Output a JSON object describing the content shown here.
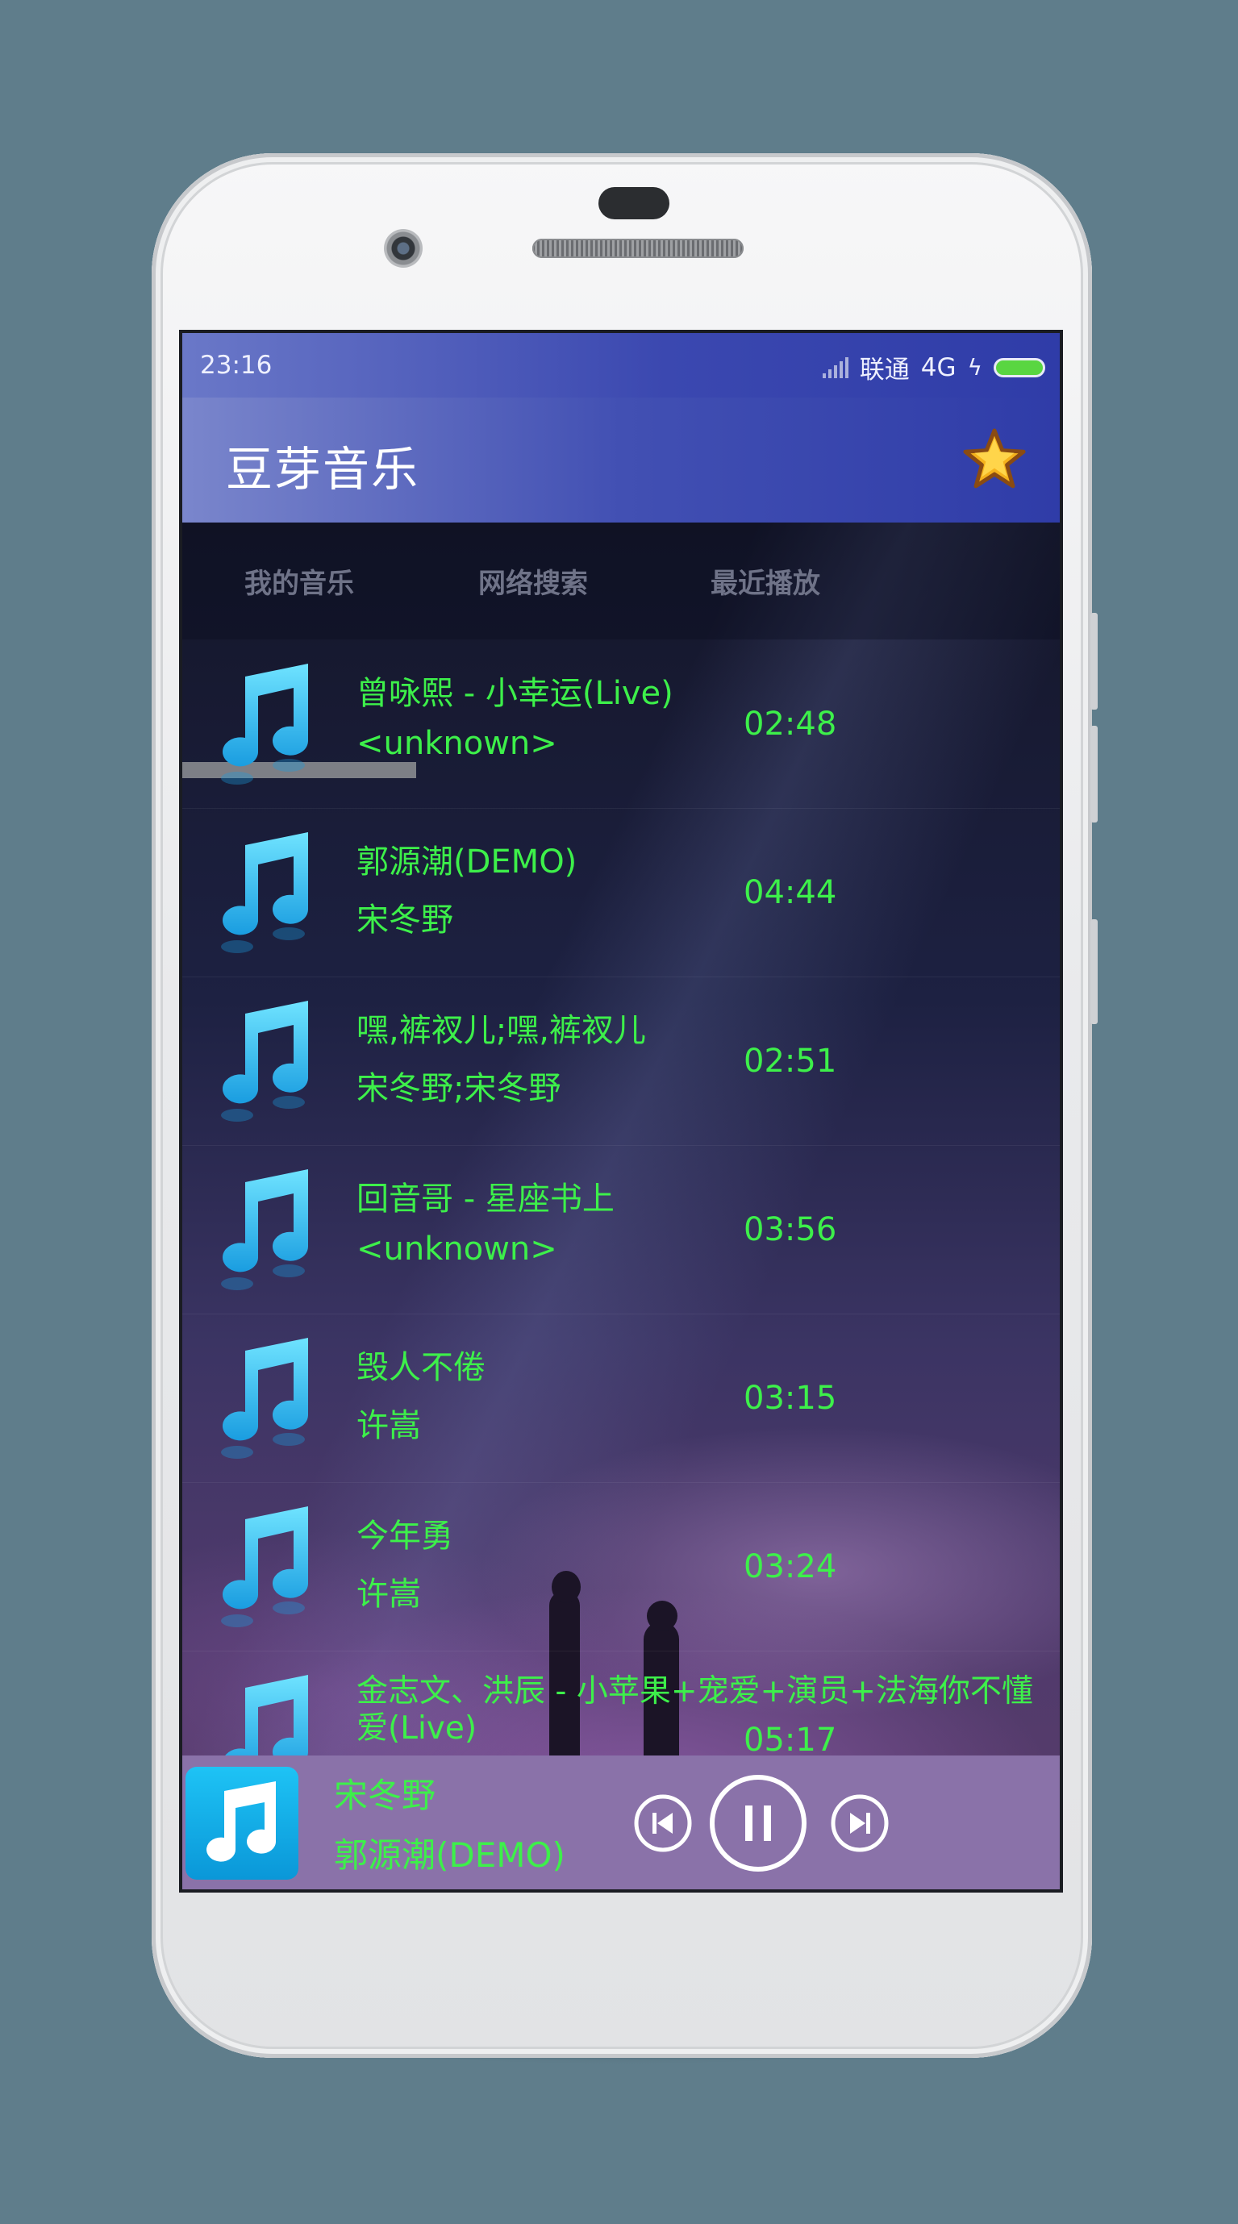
{
  "status_bar": {
    "time": "23:16",
    "carrier": "联通",
    "network": "4G"
  },
  "app": {
    "title": "豆芽音乐",
    "accent_color": "#3df04a",
    "toolbar_color": "#3b48b0",
    "favorite_icon": "star-icon"
  },
  "tabs": [
    {
      "label": "我的音乐",
      "selected": true
    },
    {
      "label": "网络搜索",
      "selected": false
    },
    {
      "label": "最近播放",
      "selected": false
    }
  ],
  "songs": [
    {
      "title": "曾咏熙 - 小幸运(Live)",
      "artist": "<unknown>",
      "duration": "02:48"
    },
    {
      "title": "郭源潮(DEMO)",
      "artist": "宋冬野",
      "duration": "04:44"
    },
    {
      "title": "嘿,裤衩儿;嘿,裤衩儿",
      "artist": "宋冬野;宋冬野",
      "duration": "02:51"
    },
    {
      "title": "回音哥 - 星座书上",
      "artist": "<unknown>",
      "duration": "03:56"
    },
    {
      "title": "毁人不倦",
      "artist": "许嵩",
      "duration": "03:15"
    },
    {
      "title": "今年勇",
      "artist": "许嵩",
      "duration": "03:24"
    },
    {
      "title": "金志文、洪辰 - 小苹果+宠爱+演员+法海你不懂爱(Live)",
      "artist": "",
      "duration": "05:17"
    }
  ],
  "now_playing": {
    "artist": "宋冬野",
    "title": "郭源潮(DEMO)",
    "state": "playing"
  }
}
